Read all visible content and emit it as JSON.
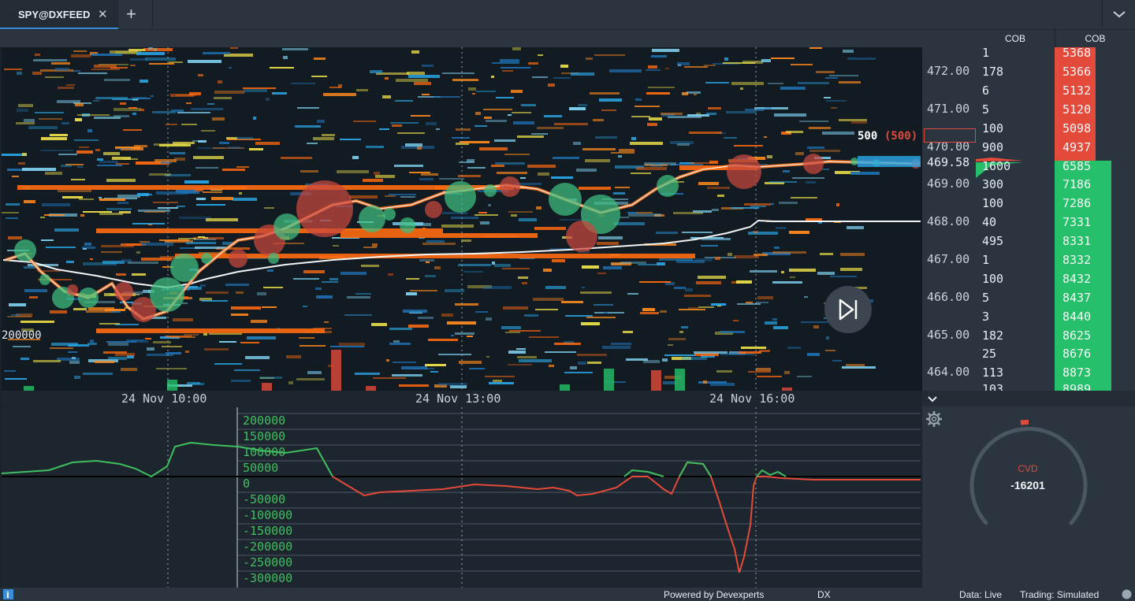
{
  "tab": {
    "label": "SPY@DXFEED",
    "close": "✕",
    "add": "+"
  },
  "chart": {
    "volume_label": "200000",
    "order_label_qty": "500",
    "order_label_filled": "(500)",
    "time_labels": [
      "24 Nov 10:00",
      "24 Nov 13:00",
      "24 Nov 16:00"
    ],
    "price_labels": [
      "472.00",
      "471.00",
      "470.00",
      "469.00",
      "468.00",
      "467.00",
      "466.00",
      "465.00",
      "464.00"
    ],
    "current_price": "469.58"
  },
  "book": {
    "headers": [
      "COB",
      "COB"
    ],
    "asks": [
      {
        "q": "1",
        "c": "5368"
      },
      {
        "q": "178",
        "c": "5366"
      },
      {
        "q": "6",
        "c": "5132"
      },
      {
        "q": "5",
        "c": "5120"
      },
      {
        "q": "100",
        "c": "5098"
      },
      {
        "q": "900",
        "c": "4937"
      }
    ],
    "bids": [
      {
        "q": "1600",
        "c": "6585"
      },
      {
        "q": "300",
        "c": "7186"
      },
      {
        "q": "100",
        "c": "7286"
      },
      {
        "q": "40",
        "c": "7331"
      },
      {
        "q": "495",
        "c": "8331"
      },
      {
        "q": "1",
        "c": "8332"
      },
      {
        "q": "100",
        "c": "8432"
      },
      {
        "q": "5",
        "c": "8437"
      },
      {
        "q": "3",
        "c": "8440"
      },
      {
        "q": "182",
        "c": "8625"
      },
      {
        "q": "25",
        "c": "8676"
      },
      {
        "q": "113",
        "c": "8873"
      },
      {
        "q": "103",
        "c": "8989"
      }
    ]
  },
  "indicator": {
    "labels": [
      "200000",
      "150000",
      "100000",
      "50000",
      "0",
      "-50000",
      "-100000",
      "-150000",
      "-200000",
      "-250000",
      "-300000"
    ]
  },
  "gauge": {
    "label": "CVD",
    "value": "-16201"
  },
  "status": {
    "powered": "Powered by Devexperts",
    "dx": "DX",
    "data": "Data: Live",
    "trading": "Trading: Simulated"
  },
  "colors": {
    "up": "#27c06a",
    "down": "#e44a3a",
    "accent": "#3d8ed8"
  }
}
